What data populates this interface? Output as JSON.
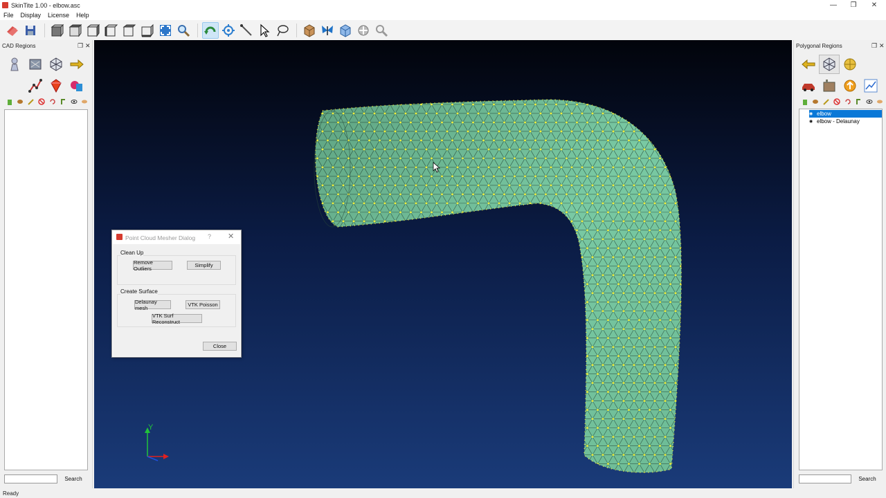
{
  "window": {
    "title": "SkinTite 1.00 - elbow.asc",
    "controls": [
      "—",
      "❐",
      "✕"
    ]
  },
  "menu": [
    "File",
    "Display",
    "License",
    "Help"
  ],
  "toolbar": {
    "groups": [
      [
        "open-icon",
        "save-icon"
      ],
      [
        "view-front-icon",
        "view-back-icon",
        "view-left-icon",
        "view-right-icon",
        "view-top-icon",
        "view-bottom-icon",
        "fit-all-icon",
        "zoom-icon"
      ],
      [
        "rotate-icon",
        "center-icon",
        "measure-icon",
        "select-pointer-icon",
        "lasso-icon"
      ],
      [
        "box-icon",
        "butterfly-icon",
        "cube-net-icon",
        "joystick-icon",
        "magnifier-icon"
      ]
    ]
  },
  "left_panel": {
    "title": "CAD Regions",
    "icons_row1": [
      "pawn-icon",
      "scanner-icon",
      "mesh-icon",
      "arrow-right-icon"
    ],
    "icons_row2": [
      "polyline-icon",
      "gem-icon",
      "shapes-icon"
    ],
    "small_icons": [
      "trash-icon",
      "potato-icon",
      "pencil-icon",
      "ban-icon",
      "undo-icon",
      "branch-icon",
      "eye-icon",
      "mouth-icon"
    ],
    "search_value": "",
    "search_button": "Search"
  },
  "right_panel": {
    "title": "Polygonal Regions",
    "icons_row1": [
      "arrow-left-icon",
      "mesh-icon",
      "sphere-icon"
    ],
    "icons_row2": [
      "car-icon",
      "factory-icon",
      "upload-circle-icon",
      "chart-icon"
    ],
    "small_icons": [
      "trash-icon",
      "potato-icon",
      "pencil-icon",
      "ban-icon",
      "undo-icon",
      "branch-icon",
      "eye-icon",
      "mouth-icon"
    ],
    "tree": [
      {
        "label": "elbow",
        "selected": true
      },
      {
        "label": "elbow - Delaunay",
        "selected": false
      }
    ],
    "search_value": "",
    "search_button": "Search"
  },
  "viewport": {
    "axis_label": "Y",
    "mesh_color": "#79c9a3",
    "point_color": "#f2f03a"
  },
  "dialog": {
    "title": "Point Cloud Mesher Dialog",
    "help": "?",
    "clean_up_label": "Clean Up",
    "remove_outliers": "Remove Outliers",
    "simplify": "Simplify",
    "create_surface_label": "Create Surface",
    "delaunay": "Delaunay mesh",
    "vtk_poisson": "VTK Poisson",
    "vtk_surf": "VTK Surf Reconstruct",
    "close": "Close"
  },
  "status": "Ready"
}
